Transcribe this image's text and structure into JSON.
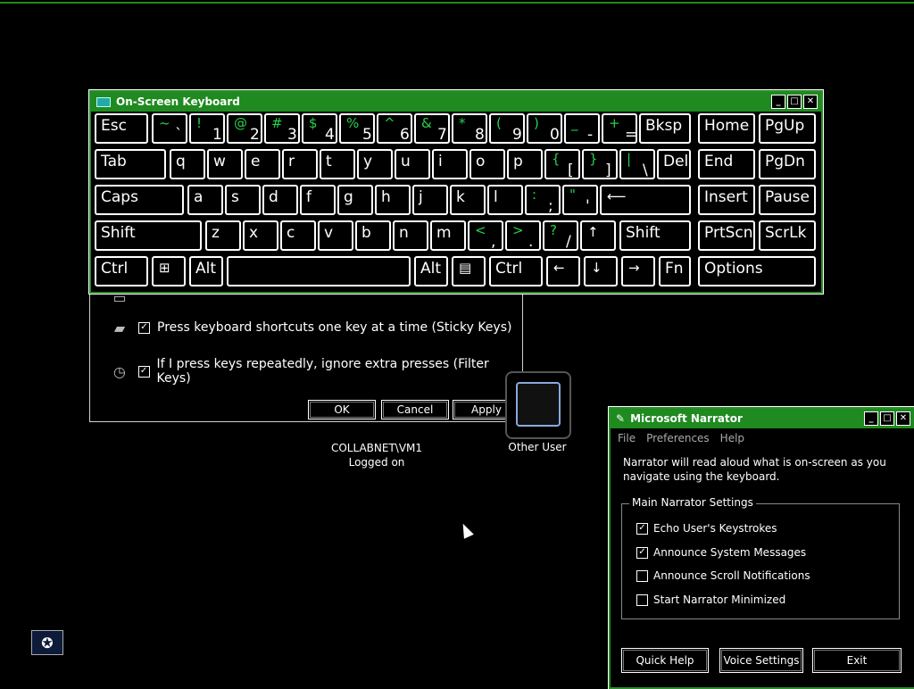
{
  "accessibility_dialog": {
    "rows": [
      {
        "label": "Press keyboard shortcuts one key at a time (Sticky Keys)",
        "checked": true,
        "icon": "keyboard-icon"
      },
      {
        "label": "If I press keys repeatedly, ignore extra presses (Filter Keys)",
        "checked": true,
        "icon": "stopwatch-icon"
      }
    ],
    "buttons": {
      "ok": "OK",
      "cancel": "Cancel",
      "apply": "Apply"
    }
  },
  "user_tiles": {
    "collabnet": {
      "line1": "COLLABNET\\VM1",
      "line2": "Logged on"
    },
    "other": {
      "label": "Other User"
    }
  },
  "osk": {
    "title": "On-Screen Keyboard",
    "keys": {
      "esc": "Esc",
      "bksp": "Bksp",
      "home": "Home",
      "pgup": "PgUp",
      "tab": "Tab",
      "del": "Del",
      "end": "End",
      "pgdn": "PgDn",
      "caps": "Caps",
      "insert": "Insert",
      "pause": "Pause",
      "shift_l": "Shift",
      "shift_r": "Shift",
      "prtscn": "PrtScn",
      "scrlk": "ScrLk",
      "ctrl_l": "Ctrl",
      "alt_l": "Alt",
      "alt_r": "Alt",
      "ctrl_r": "Ctrl",
      "fn": "Fn",
      "options": "Options",
      "up": "↑",
      "left": "←",
      "down": "↓",
      "right": "→",
      "win": "⊞",
      "menu": "▤"
    },
    "number_row": [
      {
        "sh": "~",
        "lo": "`"
      },
      {
        "sh": "!",
        "lo": "1"
      },
      {
        "sh": "@",
        "lo": "2"
      },
      {
        "sh": "#",
        "lo": "3"
      },
      {
        "sh": "$",
        "lo": "4"
      },
      {
        "sh": "%",
        "lo": "5"
      },
      {
        "sh": "^",
        "lo": "6"
      },
      {
        "sh": "&",
        "lo": "7"
      },
      {
        "sh": "*",
        "lo": "8"
      },
      {
        "sh": "(",
        "lo": "9"
      },
      {
        "sh": ")",
        "lo": "0"
      },
      {
        "sh": "_",
        "lo": "-"
      },
      {
        "sh": "+",
        "lo": "="
      }
    ],
    "row_q": [
      "q",
      "w",
      "e",
      "r",
      "t",
      "y",
      "u",
      "i",
      "o",
      "p"
    ],
    "row_q_extra": [
      {
        "sh": "{",
        "lo": "["
      },
      {
        "sh": "}",
        "lo": "]"
      },
      {
        "sh": "|",
        "lo": "\\"
      }
    ],
    "row_a": [
      "a",
      "s",
      "d",
      "f",
      "g",
      "h",
      "j",
      "k",
      "l"
    ],
    "row_a_extra": [
      {
        "sh": ":",
        "lo": ";"
      },
      {
        "sh": "\"",
        "lo": "'"
      }
    ],
    "row_z": [
      "z",
      "x",
      "c",
      "v",
      "b",
      "n",
      "m"
    ],
    "row_z_extra": [
      {
        "sh": "<",
        "lo": ","
      },
      {
        "sh": ">",
        "lo": "."
      },
      {
        "sh": "?",
        "lo": "/"
      }
    ],
    "enter": "⟵"
  },
  "narrator": {
    "title": "Microsoft Narrator",
    "menu": {
      "file": "File",
      "preferences": "Preferences",
      "help": "Help"
    },
    "description": "Narrator will read aloud what is on-screen as you navigate using the keyboard.",
    "group_label": "Main Narrator Settings",
    "options": [
      {
        "label": "Echo User's Keystrokes",
        "checked": true
      },
      {
        "label": "Announce System Messages",
        "checked": true
      },
      {
        "label": "Announce Scroll Notifications",
        "checked": false
      },
      {
        "label": "Start Narrator Minimized",
        "checked": false
      }
    ],
    "buttons": {
      "quick_help": "Quick Help",
      "voice_settings": "Voice Settings",
      "exit": "Exit"
    }
  },
  "colors": {
    "title_green": "#1f8a1f",
    "shift_green": "#27d24a"
  }
}
